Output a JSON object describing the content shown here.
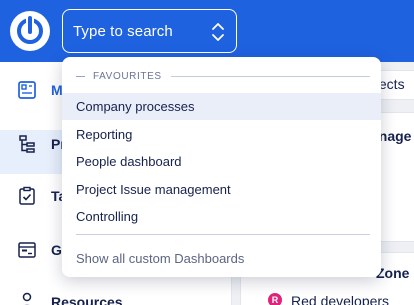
{
  "header": {
    "search_placeholder": "Type to search"
  },
  "sidebar": {
    "items": [
      {
        "label": "M",
        "icon": "dashboard-icon"
      },
      {
        "label": "Pr",
        "icon": "tree-structure-icon"
      },
      {
        "label": "Ta",
        "icon": "clipboard-check-icon"
      },
      {
        "label": "G",
        "icon": "gantt-chart-icon"
      },
      {
        "label": "Resources",
        "icon": "person-icon"
      }
    ]
  },
  "main": {
    "tab_text": "ojects",
    "heading_text": "anage",
    "zone_text": "Zone",
    "team_badge": "R",
    "team_name": "Red developers"
  },
  "dropdown": {
    "section_label": "FAVOURITES",
    "items": [
      "Company processes",
      "Reporting",
      "People dashboard",
      "Project Issue management",
      "Controlling"
    ],
    "footer_link": "Show all custom Dashboards"
  },
  "colors": {
    "brand_blue": "#1f62e0",
    "text_dark": "#16224d",
    "hover_bg": "#e9eef9",
    "badge_pink": "#e0247c"
  }
}
